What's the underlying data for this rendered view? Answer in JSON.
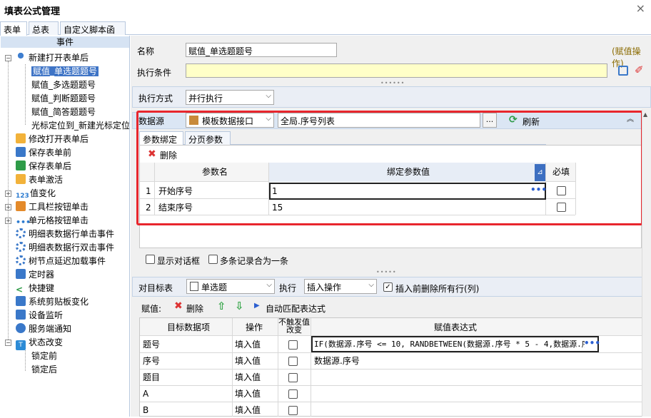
{
  "window": {
    "title": "填表公式管理",
    "close": "×"
  },
  "tabs": [
    "表单",
    "总表",
    "自定义脚本函数"
  ],
  "tree": {
    "header": "事件",
    "items": [
      {
        "label": "新建打开表单后"
      },
      {
        "label": "赋值_单选题题号"
      },
      {
        "label": "赋值_多选题题号"
      },
      {
        "label": "赋值_判断题题号"
      },
      {
        "label": "赋值_简答题题号"
      },
      {
        "label": "光标定位到_新建光标定位"
      },
      {
        "label": "修改打开表单后"
      },
      {
        "label": "保存表单前"
      },
      {
        "label": "保存表单后"
      },
      {
        "label": "表单激活"
      },
      {
        "label": "值变化"
      },
      {
        "label": "工具栏按钮单击"
      },
      {
        "label": "单元格按钮单击"
      },
      {
        "label": "明细表数据行单击事件"
      },
      {
        "label": "明细表数据行双击事件"
      },
      {
        "label": "树节点延迟加载事件"
      },
      {
        "label": "定时器"
      },
      {
        "label": "快捷键"
      },
      {
        "label": "系统剪贴板变化"
      },
      {
        "label": "设备监听"
      },
      {
        "label": "服务端通知"
      },
      {
        "label": "状态改变"
      },
      {
        "label": "锁定前"
      },
      {
        "label": "锁定后"
      }
    ]
  },
  "form": {
    "name_label": "名称",
    "name_value": "赋值_单选题题号",
    "op_label": "(赋值操作)",
    "cond_label": "执行条件",
    "cond_value": "",
    "mode_label": "执行方式",
    "mode_value": "并行执行"
  },
  "datasource": {
    "label": "数据源",
    "type": "模板数据接口",
    "path": "全局.序号列表",
    "browse": "...",
    "refresh": "刷新",
    "subtabs": [
      "参数绑定",
      "分页参数"
    ],
    "delete": "删除",
    "columns": [
      "参数名",
      "绑定参数值",
      "必填"
    ],
    "rows": [
      {
        "no": "1",
        "name": "开始序号",
        "value": "1"
      },
      {
        "no": "2",
        "name": "结束序号",
        "value": "15"
      }
    ],
    "show_dialog": "显示对话框",
    "merge_label": "多条记录合为一条"
  },
  "target": {
    "label": "对目标表",
    "table": "单选题",
    "exec_label": "执行",
    "exec_value": "插入操作",
    "delete_all": "插入前删除所有行(列)",
    "assign_label": "赋值:",
    "delete": "删除",
    "auto_match": "自动匹配表达式",
    "columns": [
      "目标数据项",
      "操作",
      "不触发值改变",
      "赋值表达式"
    ],
    "rows": [
      {
        "item": "题号",
        "op": "填入值",
        "expr": "IF(数据源.序号  <= 10, RANDBETWEEN(数据源.序号 * 5 - 4,数据源.序号"
      },
      {
        "item": "序号",
        "op": "填入值",
        "expr": "数据源.序号"
      },
      {
        "item": "题目",
        "op": "填入值",
        "expr": ""
      },
      {
        "item": "A",
        "op": "填入值",
        "expr": ""
      },
      {
        "item": "B",
        "op": "填入值",
        "expr": ""
      }
    ]
  },
  "colors": {
    "accent": "#3e74c6",
    "highlight": "#e8262d",
    "condbg": "#ffffc8"
  }
}
